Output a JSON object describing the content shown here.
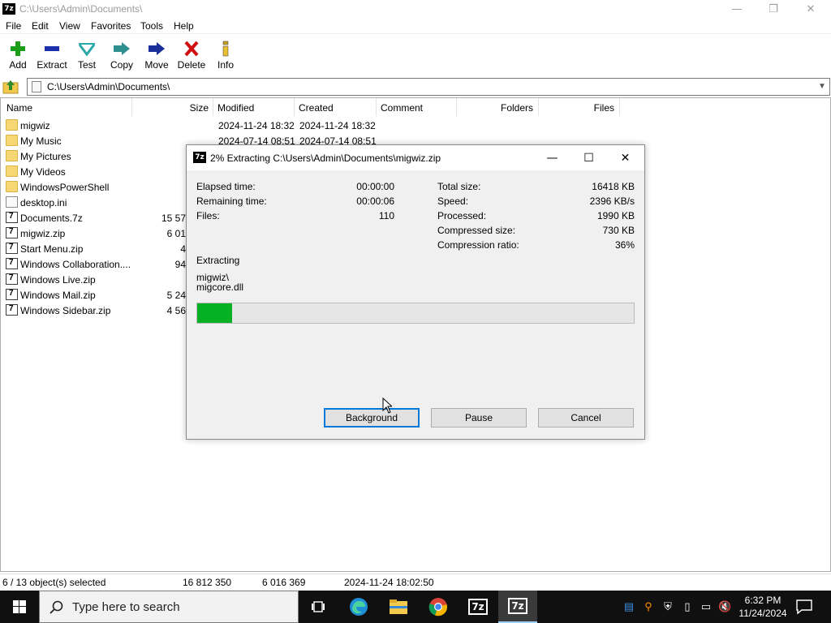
{
  "window": {
    "title": "C:\\Users\\Admin\\Documents\\",
    "app_icon_text": "7z",
    "controls": {
      "minimize": "—",
      "restore": "❐",
      "close": "✕"
    }
  },
  "menu": [
    "File",
    "Edit",
    "View",
    "Favorites",
    "Tools",
    "Help"
  ],
  "toolbar": [
    {
      "label": "Add",
      "icon": "add-icon",
      "color": "#1a9e1a"
    },
    {
      "label": "Extract",
      "icon": "extract-icon",
      "color": "#1a2fa8"
    },
    {
      "label": "Test",
      "icon": "test-icon",
      "color": "#2aa8a8"
    },
    {
      "label": "Copy",
      "icon": "copy-icon",
      "color": "#2f8f8f"
    },
    {
      "label": "Move",
      "icon": "move-icon",
      "color": "#1a2f9a"
    },
    {
      "label": "Delete",
      "icon": "delete-icon",
      "color": "#d01010"
    },
    {
      "label": "Info",
      "icon": "info-icon",
      "color": "#c8a020"
    }
  ],
  "address": {
    "path": "C:\\Users\\Admin\\Documents\\"
  },
  "columns": [
    "Name",
    "Size",
    "Modified",
    "Created",
    "Comment",
    "Folders",
    "Files"
  ],
  "files": [
    {
      "name": "migwiz",
      "type": "folder",
      "size": "",
      "modified": "2024-11-24 18:32",
      "created": "2024-11-24 18:32"
    },
    {
      "name": "My Music",
      "type": "folder",
      "size": "",
      "modified": "2024-07-14 08:51",
      "created": "2024-07-14 08:51"
    },
    {
      "name": "My Pictures",
      "type": "folder",
      "size": "",
      "modified": "",
      "created": ""
    },
    {
      "name": "My Videos",
      "type": "folder",
      "size": "",
      "modified": "",
      "created": ""
    },
    {
      "name": "WindowsPowerShell",
      "type": "folder",
      "size": "",
      "modified": "",
      "created": ""
    },
    {
      "name": "desktop.ini",
      "type": "ini",
      "size": "",
      "modified": "",
      "created": ""
    },
    {
      "name": "Documents.7z",
      "type": "zip",
      "size": "15 57",
      "modified": "",
      "created": ""
    },
    {
      "name": "migwiz.zip",
      "type": "zip",
      "size": "6 01",
      "modified": "",
      "created": ""
    },
    {
      "name": "Start Menu.zip",
      "type": "zip",
      "size": "4",
      "modified": "",
      "created": ""
    },
    {
      "name": "Windows Collaboration....",
      "type": "zip",
      "size": "94",
      "modified": "",
      "created": ""
    },
    {
      "name": "Windows Live.zip",
      "type": "zip",
      "size": "",
      "modified": "",
      "created": ""
    },
    {
      "name": "Windows Mail.zip",
      "type": "zip",
      "size": "5 24",
      "modified": "",
      "created": ""
    },
    {
      "name": "Windows Sidebar.zip",
      "type": "zip",
      "size": "4 56",
      "modified": "",
      "created": ""
    }
  ],
  "status": {
    "selected": "6 / 13 object(s) selected",
    "total_size": "16 812 350",
    "packed_size": "6 016 369",
    "modified": "2024-11-24 18:02:50"
  },
  "dialog": {
    "title": "2% Extracting C:\\Users\\Admin\\Documents\\migwiz.zip",
    "left_stats": [
      {
        "label": "Elapsed time:",
        "value": "00:00:00"
      },
      {
        "label": "Remaining time:",
        "value": "00:00:06"
      },
      {
        "label": "Files:",
        "value": "110"
      }
    ],
    "right_stats": [
      {
        "label": "Total size:",
        "value": "16418 KB"
      },
      {
        "label": "Speed:",
        "value": "2396 KB/s"
      },
      {
        "label": "Processed:",
        "value": "1990 KB"
      },
      {
        "label": "Compressed size:",
        "value": "730 KB"
      },
      {
        "label": "Compression ratio:",
        "value": "36%"
      }
    ],
    "action": "Extracting",
    "current_folder": "migwiz\\",
    "current_file": "migcore.dll",
    "progress_fraction": 0.08,
    "buttons": {
      "background": "Background",
      "pause": "Pause",
      "cancel": "Cancel"
    },
    "progress_color": "#06b025"
  },
  "taskbar": {
    "search_placeholder": "Type here to search",
    "time": "6:32 PM",
    "date": "11/24/2024",
    "icons": [
      "task-view-icon",
      "edge-icon",
      "file-explorer-icon",
      "chrome-icon",
      "7zip-icon",
      "7zip-active-icon"
    ]
  }
}
